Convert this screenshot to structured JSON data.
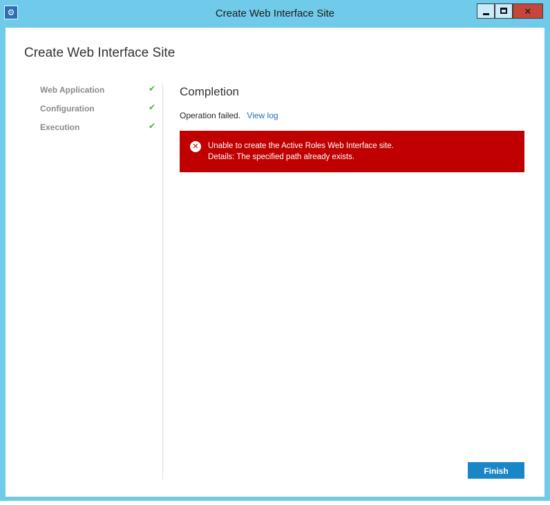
{
  "window": {
    "title": "Create Web Interface Site",
    "app_icon": "app-icon",
    "controls": {
      "minimize": "minimize-icon",
      "maximize": "maximize-icon",
      "close": "close-icon"
    }
  },
  "page": {
    "title": "Create Web Interface Site"
  },
  "steps": [
    {
      "label": "Web Application",
      "status": "done"
    },
    {
      "label": "Configuration",
      "status": "done"
    },
    {
      "label": "Execution",
      "status": "done"
    }
  ],
  "completion": {
    "title": "Completion",
    "status_text": "Operation failed.",
    "link_label": "View log",
    "error": {
      "line1": "Unable to create the Active Roles Web Interface site.",
      "line2": "Details: The specified path already exists."
    }
  },
  "buttons": {
    "finish": "Finish"
  },
  "colors": {
    "accent": "#1a86c6",
    "error": "#c00000",
    "check": "#4caf3c",
    "frame": "#6fcbe9"
  }
}
